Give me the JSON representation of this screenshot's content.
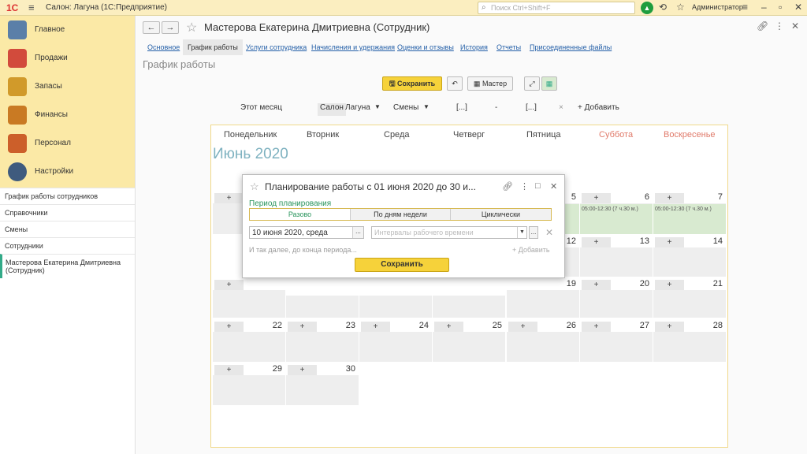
{
  "topbar": {
    "logo": "1С",
    "app_title": "Салон: Лагуна  (1С:Предприятие)",
    "search_placeholder": "Поиск Ctrl+Shift+F",
    "user": "Администратор"
  },
  "sidebar": {
    "sections": [
      {
        "label": "Главное",
        "icon": "clipboard-icon",
        "color": "#5b7fa8"
      },
      {
        "label": "Продажи",
        "icon": "chart-icon",
        "color": "#d24b3c"
      },
      {
        "label": "Запасы",
        "icon": "boxes-icon",
        "color": "#d19a2a"
      },
      {
        "label": "Финансы",
        "icon": "wallet-icon",
        "color": "#c97a23"
      },
      {
        "label": "Персонал",
        "icon": "people-icon",
        "color": "#cc5f2a"
      },
      {
        "label": "Настройки",
        "icon": "gear-icon",
        "color": "#3f5b7e"
      }
    ],
    "nav": [
      "График работы сотрудников",
      "Справочники",
      "Смены",
      "Сотрудники",
      "Мастерова Екатерина Дмитриевна (Сотрудник)"
    ]
  },
  "doc": {
    "title": "Мастерова Екатерина Дмитриевна (Сотрудник)",
    "tabs": [
      "Основное",
      "График работы",
      "Услуги сотрудника",
      "Начисления и удержания",
      "Оценки и отзывы",
      "История",
      "Отчеты",
      "Присоединенные файлы"
    ],
    "section_title": "График работы"
  },
  "toolbar": {
    "save": "Сохранить",
    "master": "Мастер"
  },
  "filters": {
    "period": "Этот месяц",
    "salon_label": "Салон",
    "salon_value": "Лагуна",
    "shifts": "Смены",
    "from": "[...]",
    "dash": "-",
    "to": "[...]",
    "clear": "×",
    "add": "+ Добавить"
  },
  "calendar": {
    "weekdays": [
      "Понедельник",
      "Вторник",
      "Среда",
      "Четверг",
      "Пятница",
      "Суббота",
      "Воскресенье"
    ],
    "month": "Июнь 2020",
    "plus": "+",
    "shift_text": "05:00-12:30 (7 ч.30 м.)",
    "days": [
      "5",
      "6",
      "7",
      "12",
      "13",
      "14",
      "19",
      "20",
      "21",
      "22",
      "23",
      "24",
      "25",
      "26",
      "27",
      "28",
      "29",
      "30"
    ]
  },
  "dialog": {
    "title": "Планирование работы с 01 июня 2020 до 30 и...",
    "period_label": "Период планирования",
    "segments": [
      "Разово",
      "По дням недели",
      "Циклически"
    ],
    "date_value": "10 июня 2020, среда",
    "dots": "...",
    "interval_placeholder": "Интервалы рабочего времени",
    "hint": "И так далее, до конца периода...",
    "add": "+ Добавить",
    "save": "Сохранить"
  }
}
